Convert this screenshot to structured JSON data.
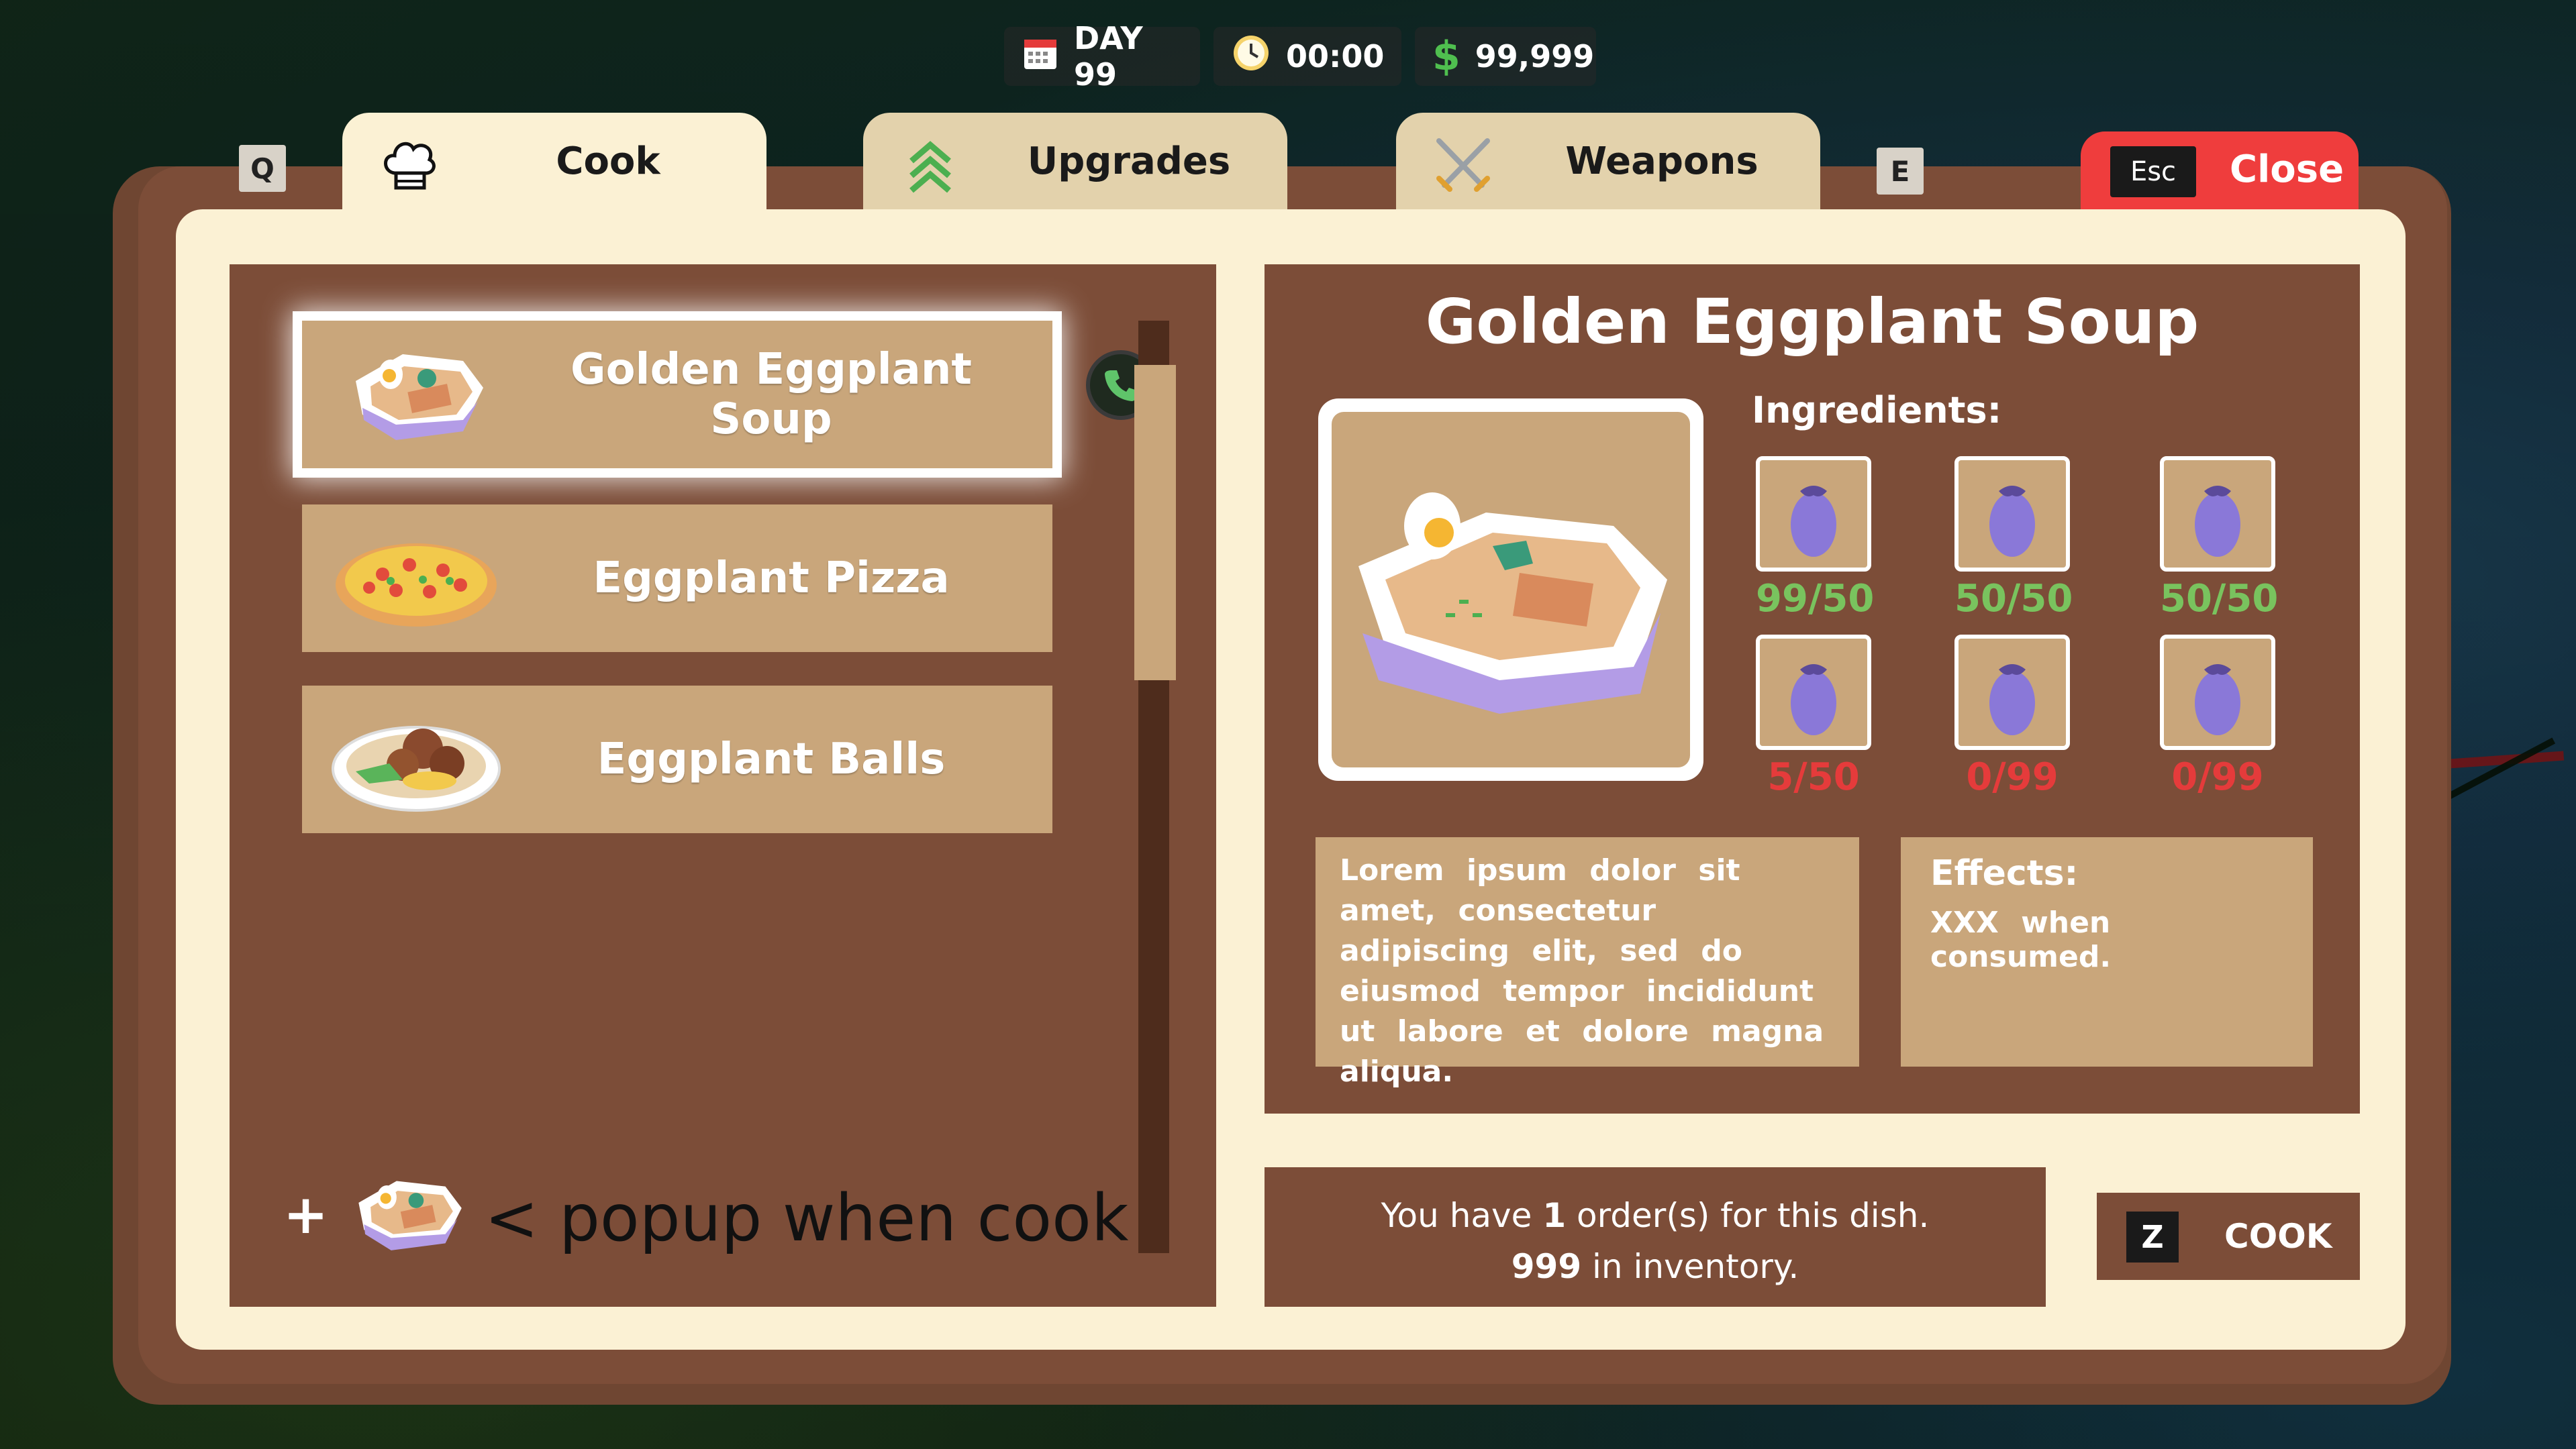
{
  "hud": {
    "day": "DAY 99",
    "time": "00:00",
    "money_symbol": "$",
    "money": "99,999"
  },
  "tabs": [
    {
      "label": "Cook",
      "icon": "chef-hat-icon",
      "active": true
    },
    {
      "label": "Upgrades",
      "icon": "upgrade-arrows-icon",
      "active": false
    },
    {
      "label": "Weapons",
      "icon": "crossed-swords-icon",
      "active": false
    }
  ],
  "keys": {
    "prev_tab": "Q",
    "next_tab": "E",
    "close": "Esc",
    "cook": "Z"
  },
  "close_label": "Close",
  "recipes": [
    {
      "name": "Golden Eggplant Soup",
      "icon": "soup-bowl-icon",
      "selected": true,
      "badge": "phone-icon"
    },
    {
      "name": "Eggplant Pizza",
      "icon": "pizza-icon",
      "selected": false
    },
    {
      "name": "Eggplant Balls",
      "icon": "meatball-plate-icon",
      "selected": false
    }
  ],
  "popup_note": {
    "plus": "+",
    "text": "< popup when cook"
  },
  "detail": {
    "title": "Golden Eggplant Soup",
    "ingredients_label": "Ingredients:",
    "ingredients": [
      {
        "icon": "eggplant-icon",
        "count": "99/50",
        "enough": true
      },
      {
        "icon": "eggplant-icon",
        "count": "50/50",
        "enough": true
      },
      {
        "icon": "eggplant-icon",
        "count": "50/50",
        "enough": true
      },
      {
        "icon": "eggplant-icon",
        "count": "5/50",
        "enough": false
      },
      {
        "icon": "eggplant-icon",
        "count": "0/99",
        "enough": false
      },
      {
        "icon": "eggplant-icon",
        "count": "0/99",
        "enough": false
      }
    ],
    "description": "Lorem ipsum dolor sit amet, consectetur adipiscing elit, sed do eiusmod tempor incididunt ut labore et dolore magna aliqua.",
    "effects_label": "Effects:",
    "effects_text": "XXX when consumed."
  },
  "order": {
    "prefix": "You have",
    "orders": "1",
    "suffix": "order(s) for this dish.",
    "inventory": "999",
    "inventory_suffix": "in inventory."
  },
  "cook_label": "COOK",
  "colors": {
    "panel_brown": "#7c4d38",
    "cream": "#fbf1d4",
    "tan": "#c9a67b",
    "close_red": "#ef3d3d",
    "ok_green": "#79c35e",
    "bad_red": "#e53b3b"
  }
}
